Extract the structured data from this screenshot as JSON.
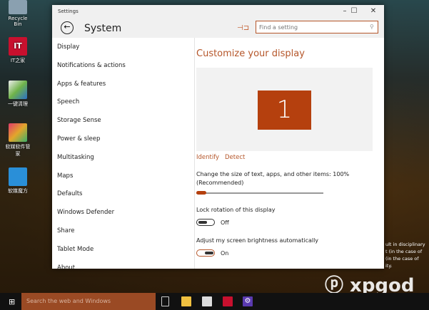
{
  "desktop": {
    "icons": [
      {
        "label": "Recycle Bin",
        "color": "#8aa0b0"
      },
      {
        "label": "IT之家",
        "color": "#c8102e"
      },
      {
        "label": "一键清理",
        "color": "#6fb34a"
      },
      {
        "label": "软媒软件管家",
        "color": "#e2a62b"
      },
      {
        "label": "软媒魔方",
        "color": "#2a8fd8"
      }
    ],
    "notice_lines": [
      "ult in disciplinary",
      "t (in the case of",
      "(in the case of",
      "ity."
    ],
    "watermark": "系统天堂 xpgod.com"
  },
  "window": {
    "title": "Settings",
    "header": "System",
    "search_placeholder": "Find a setting",
    "controls": {
      "minimize": "–",
      "maximize": "☐",
      "close": "✕"
    }
  },
  "sidebar": {
    "items": [
      "Display",
      "Notifications & actions",
      "Apps & features",
      "Speech",
      "Storage Sense",
      "Power & sleep",
      "Multitasking",
      "Maps",
      "Defaults",
      "Windows Defender",
      "Share",
      "Tablet Mode",
      "About"
    ],
    "selected": "Display"
  },
  "display": {
    "title": "Customize your display",
    "monitor_number": "1",
    "identify": "Identify",
    "detect": "Detect",
    "scale_label": "Change the size of text, apps, and other items: 100%",
    "scale_note": "(Recommended)",
    "scale_value_percent": 100,
    "lock_rotation_label": "Lock rotation of this display",
    "lock_rotation_state": "Off",
    "brightness_label": "Adjust my screen brightness automatically",
    "brightness_state": "On"
  },
  "accent": "#b5562a",
  "taskbar": {
    "search_placeholder": "Search the web and Windows"
  }
}
